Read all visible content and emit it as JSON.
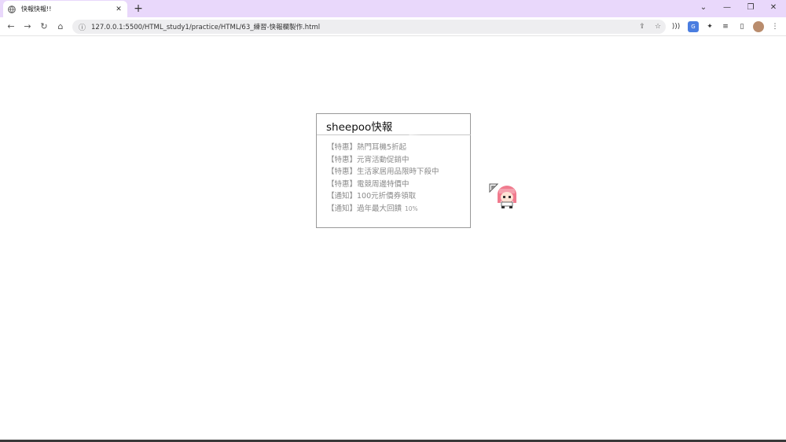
{
  "browser": {
    "tab_title": "快報快報!!",
    "tab_close": "✕",
    "new_tab": "+",
    "url": "127.0.0.1:5500/HTML_study1/practice/HTML/63_練習-快報欄製作.html",
    "window_controls": {
      "dropdown": "⌄",
      "minimize": "—",
      "restore": "❐",
      "close": "✕"
    },
    "nav": {
      "back": "←",
      "forward": "→",
      "reload": "↻",
      "home": "⌂"
    }
  },
  "panel": {
    "title": "sheepoo快報",
    "items": [
      {
        "text": "【特惠】熱門耳機5折起",
        "suffix": ""
      },
      {
        "text": "【特惠】元宵活動促銷中",
        "suffix": ""
      },
      {
        "text": "【特惠】生活家居用品限時下殺中",
        "suffix": ""
      },
      {
        "text": "【特惠】電競周邊特價中",
        "suffix": ""
      },
      {
        "text": "【通知】100元折價券領取",
        "suffix": ""
      },
      {
        "text": "【通知】過年最大回饋",
        "suffix": "10%"
      }
    ]
  },
  "icons": {
    "favicon": "globe-icon",
    "cursor": "arrow-pointer-icon",
    "sprite": "pink-hair-character-sprite"
  },
  "colors": {
    "tabstrip": "#e9d8fb",
    "panel_border": "#999999",
    "item_text": "#8a8a8a"
  }
}
